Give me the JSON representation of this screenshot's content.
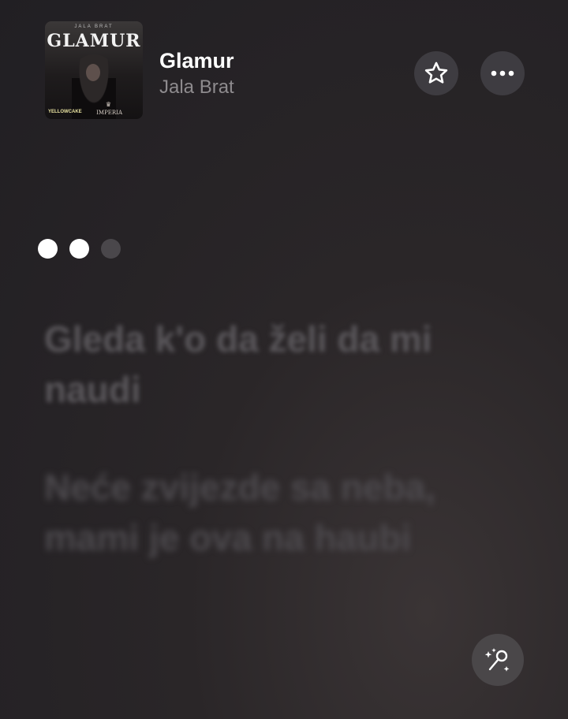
{
  "song": {
    "title": "Glamur",
    "artist": "Jala Brat"
  },
  "album_art": {
    "cover_title": "GLAMUR",
    "top_small_text": "JALA BRAT",
    "label_left": "YELLOWCAKE",
    "label_right": "IMPERIA"
  },
  "buttons": {
    "favorite_icon": "star-icon",
    "more_icon": "ellipsis-icon",
    "lyrics_icon": "microphone-sparkle-icon"
  },
  "lyrics": {
    "progress_dots": [
      true,
      true,
      false
    ],
    "lines": [
      "Gleda k'o da želi da mi naudi",
      "Neće zvijezde sa neba, mami je ova na haubi",
      ""
    ]
  },
  "colors": {
    "background": "#262327",
    "button_bg": "#3e3c41",
    "secondary_text": "#8e8b8e",
    "dimmed_lyric": "#5a575b"
  }
}
